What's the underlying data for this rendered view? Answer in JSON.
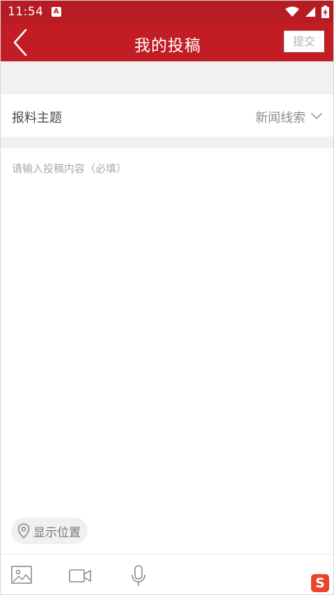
{
  "status_bar": {
    "time": "11:54",
    "notification_icon": "a-letter-notification-icon",
    "icons": [
      "wifi-icon",
      "cell-signal-icon",
      "battery-charging-icon"
    ]
  },
  "app_bar": {
    "title": "我的投稿",
    "back_icon": "chevron-left-icon",
    "submit_label": "提交"
  },
  "topic": {
    "label": "报料主题",
    "value": "新闻线索",
    "chevron_icon": "chevron-down-icon"
  },
  "content": {
    "placeholder": "请输入投稿内容（必填）",
    "value": ""
  },
  "location": {
    "icon": "location-pin-icon",
    "label": "显示位置"
  },
  "toolbar": {
    "items": [
      "image-icon",
      "video-camera-icon",
      "microphone-icon"
    ]
  },
  "ime_logo_text": "S",
  "colors": {
    "primary_red": "#c21d25",
    "status_red": "#b71c24",
    "band_gray": "#f1f1f1",
    "placeholder_gray": "#a9a9a9"
  }
}
